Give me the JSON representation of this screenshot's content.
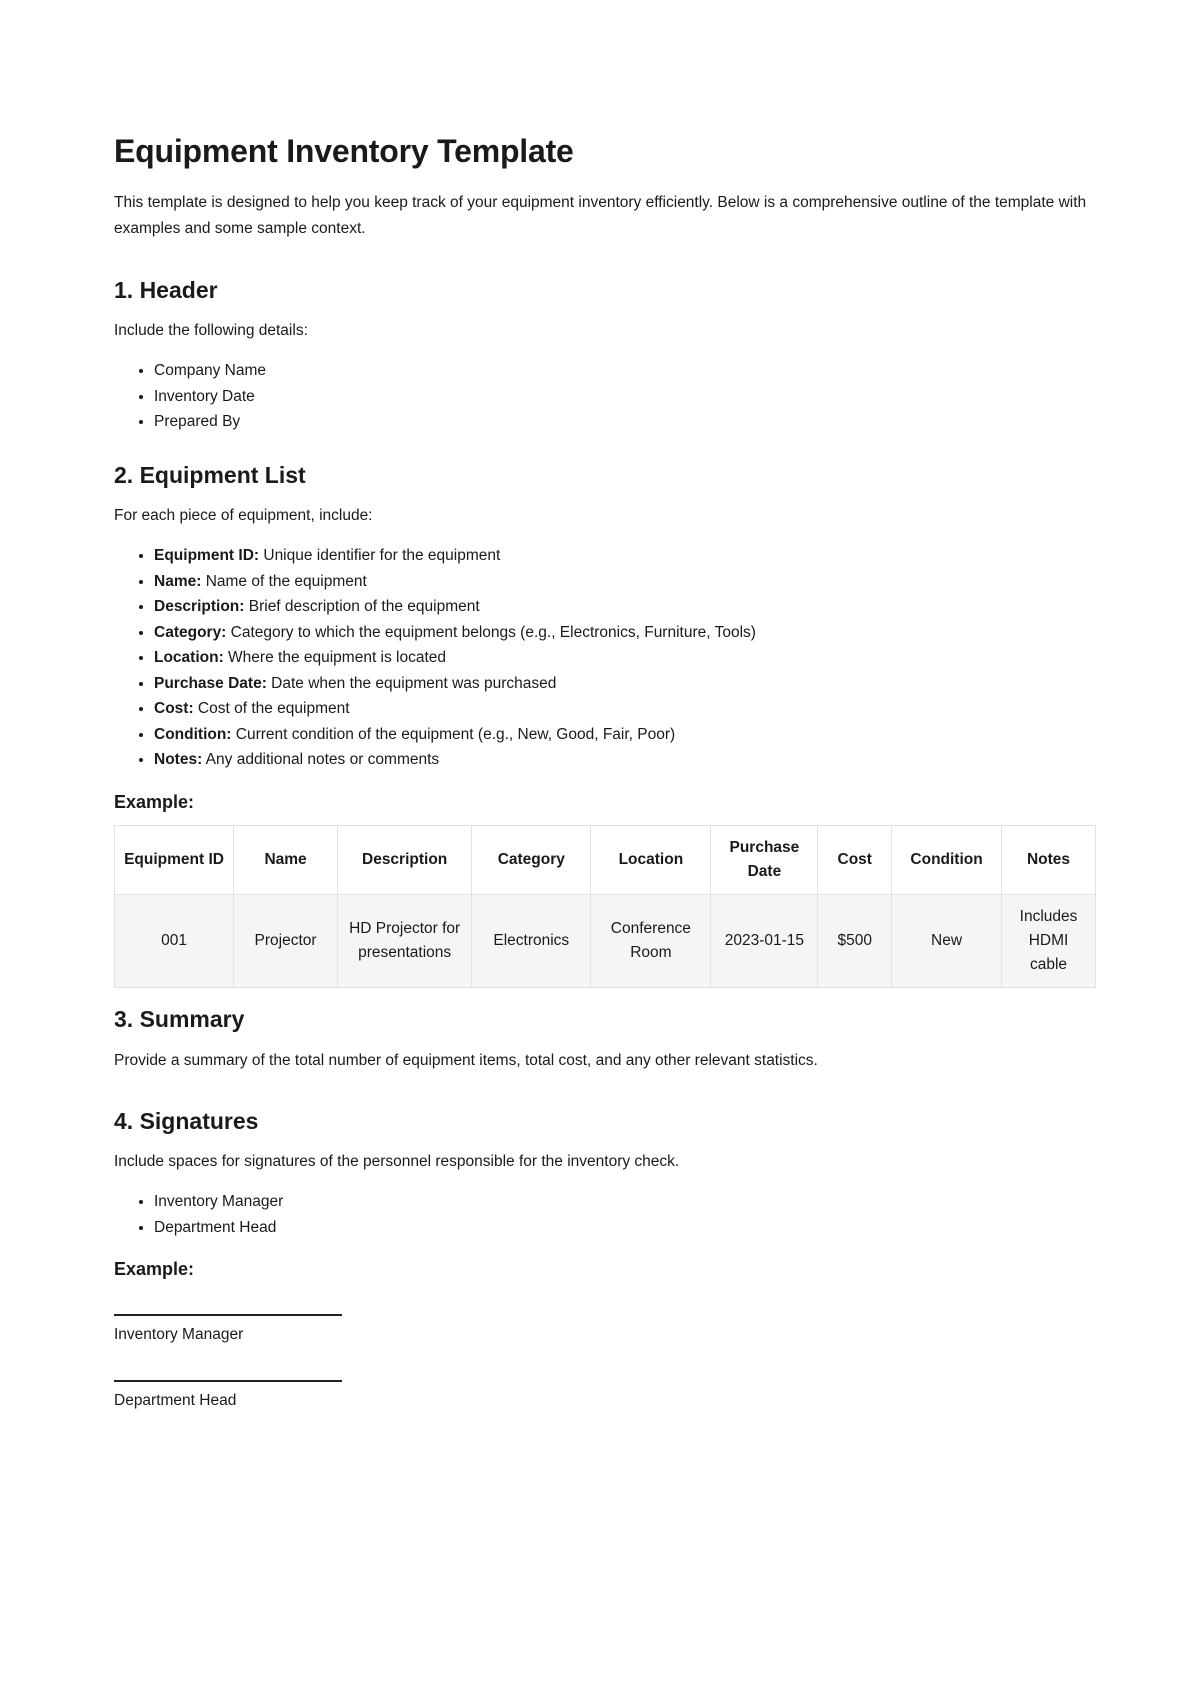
{
  "title": "Equipment Inventory Template",
  "intro": "This template is designed to help you keep track of your equipment inventory efficiently. Below is a comprehensive outline of the template with examples and some sample context.",
  "sections": {
    "header": {
      "heading": "1. Header",
      "lead": "Include the following details:",
      "items": [
        "Company Name",
        "Inventory Date",
        "Prepared By"
      ]
    },
    "equipment_list": {
      "heading": "2. Equipment List",
      "lead": "For each piece of equipment, include:",
      "items": [
        {
          "term": "Equipment ID:",
          "desc": " Unique identifier for the equipment"
        },
        {
          "term": "Name:",
          "desc": " Name of the equipment"
        },
        {
          "term": "Description:",
          "desc": " Brief description of the equipment"
        },
        {
          "term": "Category:",
          "desc": " Category to which the equipment belongs (e.g., Electronics, Furniture, Tools)"
        },
        {
          "term": "Location:",
          "desc": " Where the equipment is located"
        },
        {
          "term": "Purchase Date:",
          "desc": " Date when the equipment was purchased"
        },
        {
          "term": "Cost:",
          "desc": " Cost of the equipment"
        },
        {
          "term": "Condition:",
          "desc": " Current condition of the equipment (e.g., New, Good, Fair, Poor)"
        },
        {
          "term": "Notes:",
          "desc": " Any additional notes or comments"
        }
      ],
      "example_label": "Example:",
      "table": {
        "headers": [
          "Equipment ID",
          "Name",
          "Description",
          "Category",
          "Location",
          "Purchase Date",
          "Cost",
          "Condition",
          "Notes"
        ],
        "rows": [
          [
            "001",
            "Projector",
            "HD Projector for presentations",
            "Electronics",
            "Conference Room",
            "2023-01-15",
            "$500",
            "New",
            "Includes HDMI cable"
          ]
        ]
      }
    },
    "summary": {
      "heading": "3. Summary",
      "text": "Provide a summary of the total number of equipment items, total cost, and any other relevant statistics."
    },
    "signatures": {
      "heading": "4. Signatures",
      "lead": "Include spaces for signatures of the personnel responsible for the inventory check.",
      "items": [
        "Inventory Manager",
        "Department Head"
      ],
      "example_label": "Example:",
      "lines": [
        "Inventory Manager",
        "Department Head"
      ]
    }
  }
}
